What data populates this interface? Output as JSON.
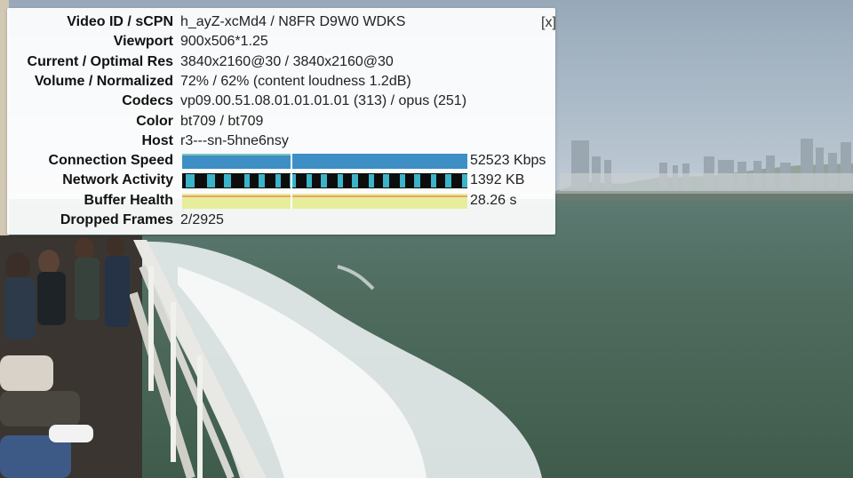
{
  "stats": {
    "close_label": "[x]",
    "rows": [
      {
        "label": "Video ID / sCPN",
        "value": "h_ayZ-xcMd4 / N8FR D9W0 WDKS"
      },
      {
        "label": "Viewport",
        "value": "900x506*1.25"
      },
      {
        "label": "Current / Optimal Res",
        "value": "3840x2160@30 / 3840x2160@30"
      },
      {
        "label": "Volume / Normalized",
        "value": "72% / 62% (content loudness 1.2dB)"
      },
      {
        "label": "Codecs",
        "value": "vp09.00.51.08.01.01.01.01 (313) / opus (251)"
      },
      {
        "label": "Color",
        "value": "bt709 / bt709"
      },
      {
        "label": "Host",
        "value": "r3---sn-5hne6nsy"
      },
      {
        "label": "Connection Speed",
        "value": "52523 Kbps"
      },
      {
        "label": "Network Activity",
        "value": "1392 KB"
      },
      {
        "label": "Buffer Health",
        "value": "28.26 s"
      },
      {
        "label": "Dropped Frames",
        "value": "2/2925"
      }
    ],
    "colors": {
      "connection_speed": "#3d8fc6",
      "network_activity": "#0d0d0d",
      "network_activity_fill": "#3bb3c9",
      "buffer_health": "#e6ee9c",
      "buffer_health_line": "#f0a070"
    }
  }
}
